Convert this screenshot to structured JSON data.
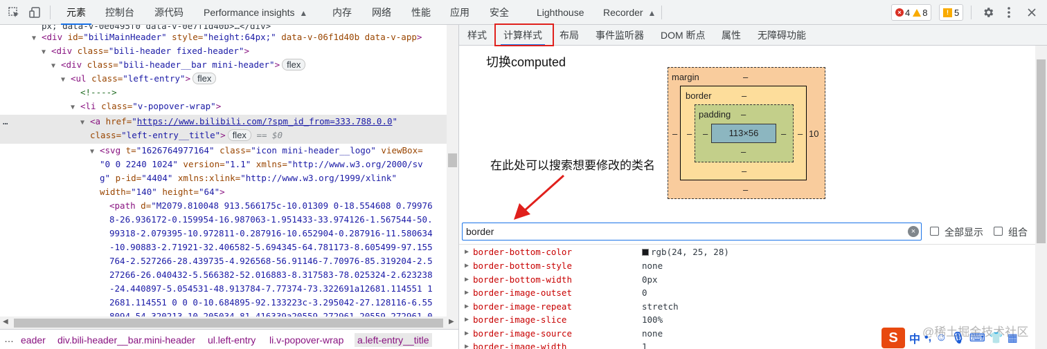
{
  "toolbar": {
    "tabs": [
      {
        "label": "元素"
      },
      {
        "label": "控制台"
      },
      {
        "label": "源代码"
      },
      {
        "label": "Performance insights"
      },
      {
        "label": "内存"
      },
      {
        "label": "网络"
      },
      {
        "label": "性能"
      },
      {
        "label": "应用"
      },
      {
        "label": "安全"
      },
      {
        "label": "Lighthouse"
      },
      {
        "label": "Recorder"
      }
    ],
    "errors": "4",
    "warnings": "8",
    "issues": "5"
  },
  "dom": {
    "l0": "px; data-v-0e0495f0 data-v-0e7f1d40b>…</div>",
    "l1_tag": "<div",
    "l1_a1": " id=",
    "l1_v1": "\"biliMainHeader\"",
    "l1_a2": " style=",
    "l1_v2": "\"height:64px;\"",
    "l1_a3": " data-v-06f1d40b data-v-app",
    "l1_end": ">",
    "l2_tag": "<div",
    "l2_a": " class=",
    "l2_v": "\"bili-header fixed-header\"",
    "l2_end": ">",
    "l3_tag": "<div",
    "l3_a": " class=",
    "l3_v": "\"bili-header__bar mini-header\"",
    "l3_end": ">",
    "l3_badge": "flex",
    "l4_tag": "<ul",
    "l4_a": " class=",
    "l4_v": "\"left-entry\"",
    "l4_end": ">",
    "l4_badge": "flex",
    "l5": "<!---->",
    "l6_tag": "<li",
    "l6_a": " class=",
    "l6_v": "\"v-popover-wrap\"",
    "l6_end": ">",
    "l7_dots": "…",
    "l7_tag": "<a",
    "l7_a": " href=",
    "l7_q1": "\"",
    "l7_link": "https://www.bilibili.com/?spm_id_from=333.788.0.0",
    "l7_q2": "\"",
    "l8_a": "class=",
    "l8_v": "\"left-entry__title\"",
    "l8_end": ">",
    "l8_badge": "flex",
    "l8_eq": "== $0",
    "l9_tag": "<svg",
    "l9_a1": " t=",
    "l9_v1": "\"1626764977164\"",
    "l9_a2": " class=",
    "l9_v2": "\"icon mini-header__logo\"",
    "l9_a3": " viewBox=",
    "l10_v": "\"0 0 2240 1024\"",
    "l10_a1": " version=",
    "l10_v1": "\"1.1\"",
    "l10_a2": " xmlns=",
    "l10_v2": "\"http://www.w3.org/2000/sv",
    "l11_v": "g\"",
    "l11_a1": " p-id=",
    "l11_v1": "\"4404\"",
    "l11_a2": " xmlns:xlink=",
    "l11_v2": "\"http://www.w3.org/1999/xlink\"",
    "l12_a1": "width=",
    "l12_v1": "\"140\"",
    "l12_a2": " height=",
    "l12_v2": "\"64\"",
    "l12_end": ">",
    "l13_tag": "<path",
    "l13_a": " d=",
    "l13_v": "\"M2079.810048 913.566175c-10.01309 0-18.554608 0.79976",
    "path_lines": [
      "8-26.936172-0.159954-16.987063-1.951433-33.974126-1.567544-50.",
      "99318-2.079395-10.972811-0.287916-10.652904-0.287916-11.580634",
      "-10.90883-2.71921-32.406582-5.694345-64.781173-8.605499-97.155",
      "764-2.527266-28.439735-4.926568-56.91146-7.70976-85.319204-2.5",
      "27266-26.040432-5.566382-52.016883-8.317583-78.025324-2.623238",
      "-24.440897-5.054531-48.913784-7.77374-73.322691a12681.114551 1",
      "2681.114551 0 0 0-10.684895-92.133223c-3.295042-27.128116-6.55",
      "8094-54.320213-10.205034-81.416339a20559.272961 20559.272961 0"
    ]
  },
  "breadcrumb": {
    "ellipsis": "…",
    "items": [
      {
        "label": "eader"
      },
      {
        "label": "div.bili-header__bar.mini-header"
      },
      {
        "label": "ul.left-entry"
      },
      {
        "label": "li.v-popover-wrap"
      },
      {
        "label": "a.left-entry__title"
      }
    ]
  },
  "styles_panel": {
    "tabs": [
      {
        "label": "样式"
      },
      {
        "label": "计算样式"
      },
      {
        "label": "布局"
      },
      {
        "label": "事件监听器"
      },
      {
        "label": "DOM 断点"
      },
      {
        "label": "属性"
      },
      {
        "label": "无障碍功能"
      }
    ],
    "annotation_top": "切换computed",
    "annotation_search": "在此处可以搜索想要修改的类名",
    "box_model": {
      "margin_label": "margin",
      "border_label": "border",
      "padding_label": "padding",
      "content": "113×56",
      "margin_top": "–",
      "margin_bottom": "–",
      "margin_left": "–",
      "margin_right": "10",
      "border_top": "–",
      "border_bottom": "–",
      "border_left": "–",
      "border_right": "–",
      "padding_top": "–",
      "padding_bottom": "–",
      "padding_left": "–",
      "padding_right": "–"
    },
    "filter_value": "border",
    "show_all_label": "全部显示",
    "group_label": "组合",
    "swatch_color": "#18191c",
    "properties": [
      {
        "name": "border-bottom-color",
        "value": "rgb(24, 25, 28)"
      },
      {
        "name": "border-bottom-style",
        "value": "none"
      },
      {
        "name": "border-bottom-width",
        "value": "0px"
      },
      {
        "name": "border-image-outset",
        "value": "0"
      },
      {
        "name": "border-image-repeat",
        "value": "stretch"
      },
      {
        "name": "border-image-slice",
        "value": "100%"
      },
      {
        "name": "border-image-source",
        "value": "none"
      },
      {
        "name": "border-image-width",
        "value": "1"
      }
    ]
  },
  "watermark": "@稀土掘金技术社区",
  "ime": {
    "logo": "S",
    "mode": "中",
    "punct": "•,"
  }
}
